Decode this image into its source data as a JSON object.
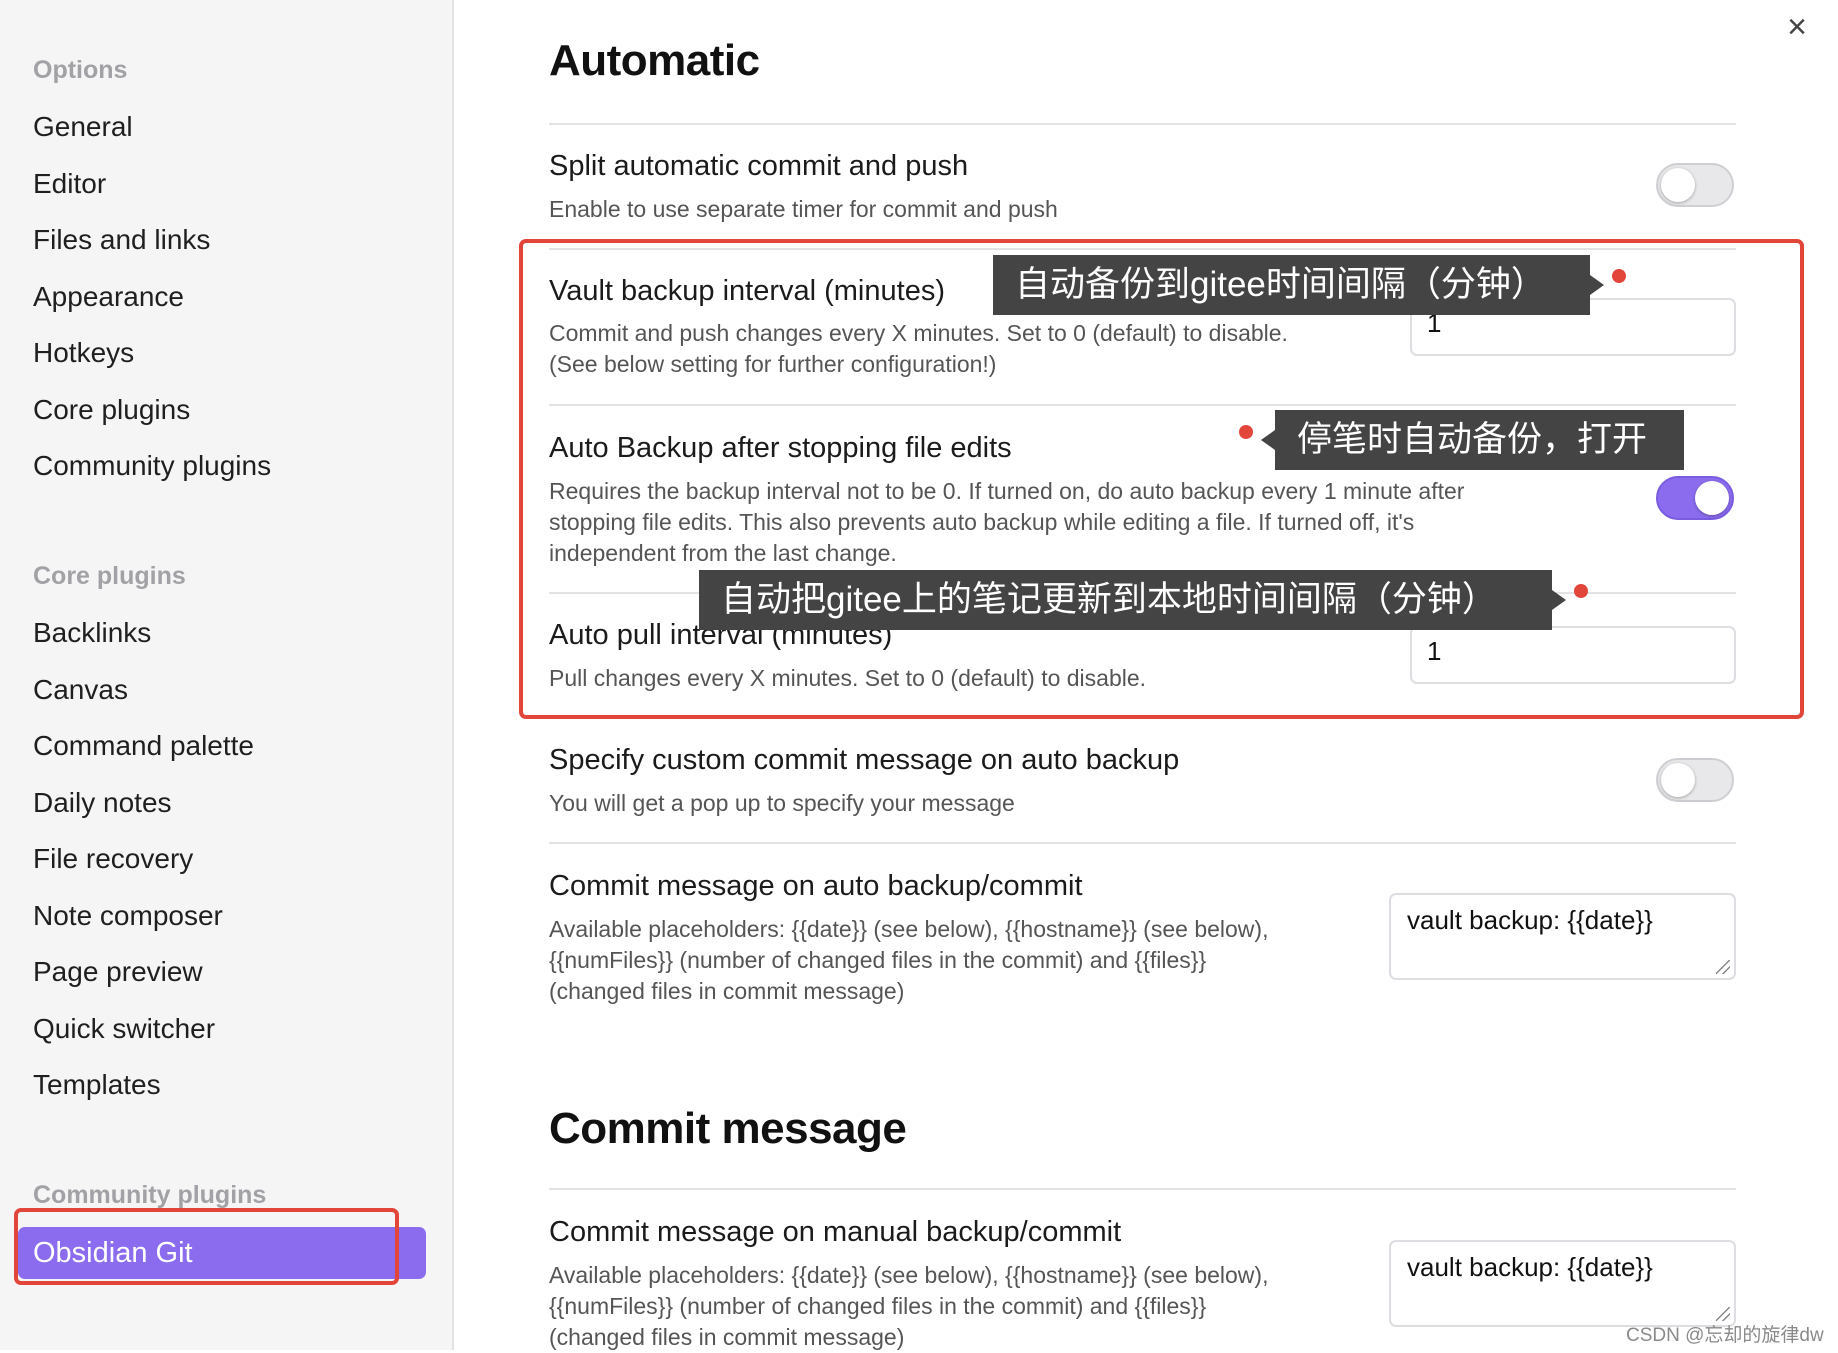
{
  "sidebar": {
    "options_label": "Options",
    "options_items": [
      "General",
      "Editor",
      "Files and links",
      "Appearance",
      "Hotkeys",
      "Core plugins",
      "Community plugins"
    ],
    "core_label": "Core plugins",
    "core_items": [
      "Backlinks",
      "Canvas",
      "Command palette",
      "Daily notes",
      "File recovery",
      "Note composer",
      "Page preview",
      "Quick switcher",
      "Templates"
    ],
    "community_label": "Community plugins",
    "active_item": "Obsidian Git"
  },
  "main": {
    "close_icon": "×",
    "heading_automatic": "Automatic",
    "heading_commit": "Commit message",
    "settings": {
      "split": {
        "title": "Split automatic commit and push",
        "desc": "Enable to use separate timer for commit and push",
        "toggle": "off"
      },
      "vault_backup": {
        "title": "Vault backup interval (minutes)",
        "desc1": "Commit and push changes every X minutes. Set to 0 (default) to disable.",
        "desc2": "(See below setting for further configuration!)",
        "value": "1"
      },
      "auto_backup": {
        "title": "Auto Backup after stopping file edits",
        "desc1": "Requires the backup interval not to be 0. If turned on, do auto backup every 1 minute after",
        "desc2": "stopping file edits. This also prevents auto backup while editing a file. If turned off, it's",
        "desc3": "independent from the last change.",
        "toggle": "on"
      },
      "auto_pull": {
        "title": "Auto pull interval (minutes)",
        "desc": "Pull changes every X minutes. Set to 0 (default) to disable.",
        "value": "1"
      },
      "custom_msg": {
        "title": "Specify custom commit message on auto backup",
        "desc": "You will get a pop up to specify your message",
        "toggle": "off"
      },
      "auto_commit_msg": {
        "title": "Commit message on auto backup/commit",
        "desc1": "Available placeholders: {{date}} (see below), {{hostname}} (see below),",
        "desc2": "{{numFiles}} (number of changed files in the commit) and {{files}}",
        "desc3": "(changed files in commit message)",
        "value": "vault backup: {{date}}"
      },
      "manual_commit_msg": {
        "title": "Commit message on manual backup/commit",
        "desc1": "Available placeholders: {{date}} (see below), {{hostname}} (see below),",
        "desc2": "{{numFiles}} (number of changed files in the commit) and {{files}}",
        "desc3": "(changed files in commit message)",
        "value": "vault backup: {{date}}"
      }
    }
  },
  "annotations": {
    "note1": "自动备份到gitee时间间隔（分钟）",
    "note2": "停笔时自动备份，打开",
    "note3": "自动把gitee上的笔记更新到本地时间间隔（分钟）"
  },
  "watermark": "CSDN @忘却的旋律dw",
  "colors": {
    "accent": "#8b6cef",
    "annotation_red": "#e2463b",
    "note_bg": "#444444"
  }
}
